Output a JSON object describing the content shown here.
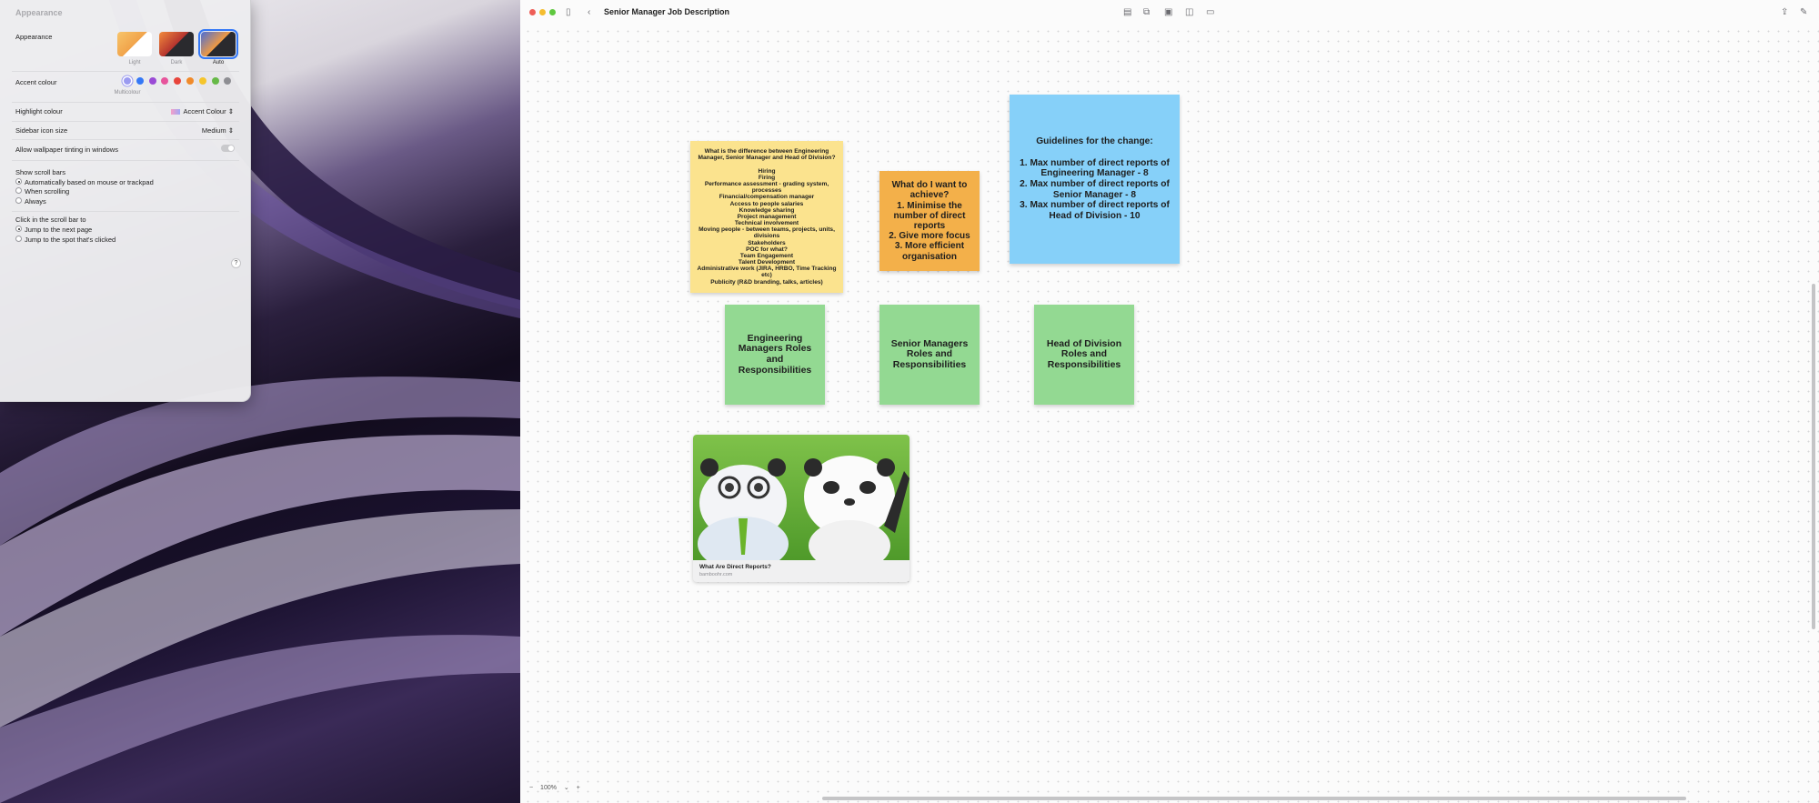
{
  "settings": {
    "title": "Appearance",
    "appearance_label": "Appearance",
    "modes": [
      "Light",
      "Dark",
      "Auto"
    ],
    "accent_label": "Accent colour",
    "accent_caption": "Multicolour",
    "accent_colors": [
      "#9b9bf0",
      "#3478f6",
      "#9a4bd6",
      "#e7549c",
      "#e8453c",
      "#f08a2a",
      "#f5c52b",
      "#67b947",
      "#8e8e93"
    ],
    "highlight_label": "Highlight colour",
    "highlight_value": "Accent Colour",
    "sidebar_label": "Sidebar icon size",
    "sidebar_value": "Medium",
    "tinting_label": "Allow wallpaper tinting in windows",
    "scroll_label": "Show scroll bars",
    "scroll_options": [
      "Automatically based on mouse or trackpad",
      "When scrolling",
      "Always"
    ],
    "click_label": "Click in the scroll bar to",
    "click_options": [
      "Jump to the next page",
      "Jump to the spot that's clicked"
    ],
    "help": "?"
  },
  "freeform": {
    "title": "Senior Manager Job Description",
    "notes": {
      "yellow": "What is the difference between Engineering Manager, Senior Manager and Head of Division?\n\nHiring\nFiring\nPerformance assessment - grading system, processes\nFinancial/compensation manager\nAccess to people salaries\nKnowledge sharing\nProject management\nTechnical involvement\nMoving people - between teams, projects, units, divisions\nStakeholders\nPOC for what?\nTeam Engagement\nTalent Development\nAdministrative work (JIRA, HRBO, Time Tracking etc)\nPublicity (R&D branding, talks, articles)",
      "orange": "What do I want to achieve?\n1. Minimise the number of direct reports\n2. Give more focus\n3. More efficient organisation",
      "blue": "Guidelines for the change:\n\n1. Max number of direct reports of Engineering Manager - 8\n2. Max number of direct reports of Senior Manager - 8\n3. Max number of direct reports of Head of Division - 10",
      "green1": "Engineering Managers Roles and Responsibilities",
      "green2": "Senior Managers Roles and Responsibilities",
      "green3": "Head of Division Roles and Responsibilities"
    },
    "link": {
      "title": "What Are Direct Reports?",
      "host": "bamboohr.com"
    },
    "zoom": {
      "minus": "−",
      "value": "100%",
      "caret": "⌄",
      "plus": "+"
    }
  }
}
